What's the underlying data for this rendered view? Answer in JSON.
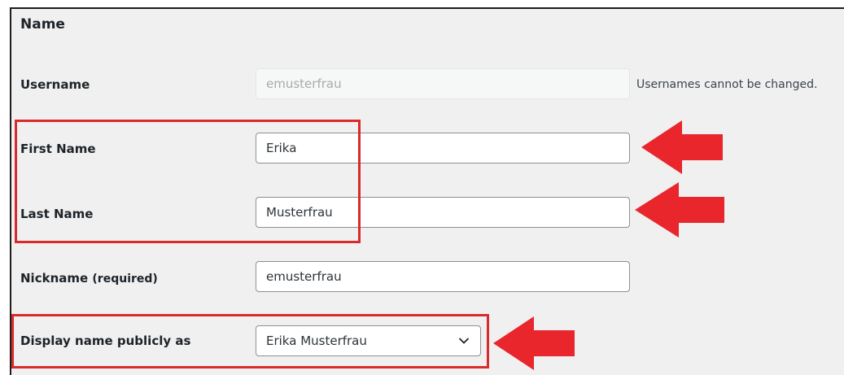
{
  "section": {
    "title": "Name"
  },
  "fields": {
    "username": {
      "label": "Username",
      "value": "emusterfrau",
      "note": "Usernames cannot be changed."
    },
    "first_name": {
      "label": "First Name",
      "value": "Erika"
    },
    "last_name": {
      "label": "Last Name",
      "value": "Musterfrau"
    },
    "nickname": {
      "label": "Nickname",
      "required": "(required)",
      "value": "emusterfrau"
    },
    "display_name": {
      "label": "Display name publicly as",
      "selected": "Erika Musterfrau"
    }
  },
  "icons": {
    "dropdown": "chevron-down-icon",
    "annotation": "red-arrow-icon"
  },
  "colors": {
    "highlight": "#d92b2b",
    "arrow": "#e8262c",
    "background": "#f0f0f1"
  }
}
